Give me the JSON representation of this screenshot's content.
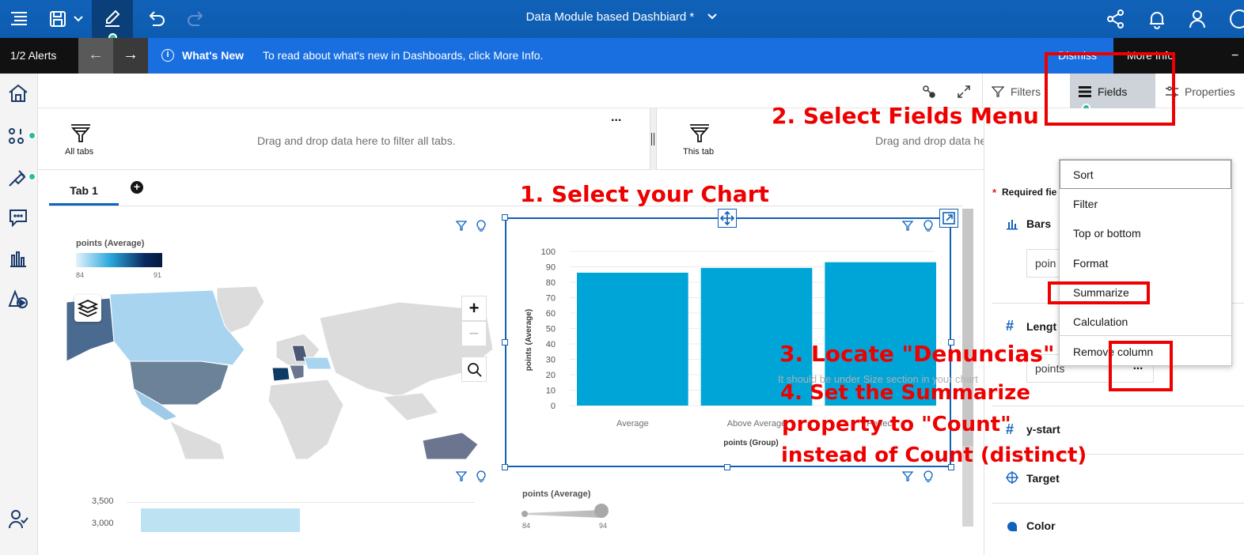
{
  "header": {
    "title": "Data Module based Dashbiard *",
    "icons": [
      "hamburger-menu-icon",
      "save-icon",
      "chevron-down-icon",
      "edit-pencil-icon",
      "undo-icon",
      "redo-icon",
      "share-icon",
      "notification-bell-icon",
      "user-icon",
      "help-icon"
    ]
  },
  "alert": {
    "count": "1/2 Alerts",
    "title": "What's New",
    "message": "To read about what's new in Dashboards, click More Info.",
    "dismiss": "Dismiss",
    "more_info": "More Info"
  },
  "toolbar": {
    "filters": "Filters",
    "fields": "Fields",
    "properties": "Properties"
  },
  "filterbar": {
    "all_tabs_label": "All tabs",
    "all_tabs_hint": "Drag and drop data here to filter all tabs.",
    "this_tab_label": "This tab",
    "this_tab_hint": "Drag and drop data here to filter this tab.",
    "more": "..."
  },
  "tabs": [
    {
      "label": "Tab 1"
    }
  ],
  "map_widget": {
    "legend_title": "points (Average)",
    "legend_min": "84",
    "legend_max": "91",
    "zoom_in": "+",
    "zoom_out": "−"
  },
  "chart_data": [
    {
      "type": "bar",
      "categories": [
        "Average",
        "Above Average",
        "Perfect"
      ],
      "visible_tick_labels": [
        "Average",
        "Above Average",
        "Perfect"
      ],
      "values": [
        86.2,
        89.3,
        93
      ],
      "xlabel": "points (Group)",
      "ylabel": "points (Average)",
      "ylim": [
        0,
        100
      ],
      "yticks": [
        "100",
        "90",
        "80",
        "70",
        "60",
        "50",
        "40",
        "30",
        "20",
        "10",
        "0"
      ],
      "color": "#00a5d8"
    },
    {
      "type": "bar",
      "yticks": [
        "3,500",
        "3,000"
      ],
      "color": "#bde3f3"
    }
  ],
  "slider_widget": {
    "title": "points (Average)",
    "min": "84",
    "max": "94"
  },
  "right_panel": {
    "required_fields": "Required fie",
    "bars_label": "Bars",
    "bars_value": "poin",
    "length_label": "Lengt",
    "length_value": "points",
    "length_hint": "It should be under Size section in your chart",
    "more_button": "...",
    "ystart_label": "y-start",
    "target_label": "Target",
    "color_label": "Color"
  },
  "context_menu": {
    "items": [
      "Sort",
      "Filter",
      "Top or bottom",
      "Format",
      "Summarize",
      "Calculation",
      "Remove column"
    ]
  },
  "annotations": {
    "step1": "1. Select your Chart",
    "step2": "2. Select Fields Menu",
    "step3": "3. Locate \"Denuncias\"",
    "step4_line1": "4. Set the Summarize",
    "step4_line2": "property to \"Count\"",
    "step4_line3": "instead of Count (distinct)"
  },
  "colors": {
    "header_blue": "#0d5cb0",
    "alert_blue": "#1a6fe0",
    "bar_blue": "#00a5d8",
    "annotation_red": "#ee0000",
    "status_green": "#2bbd9b"
  }
}
